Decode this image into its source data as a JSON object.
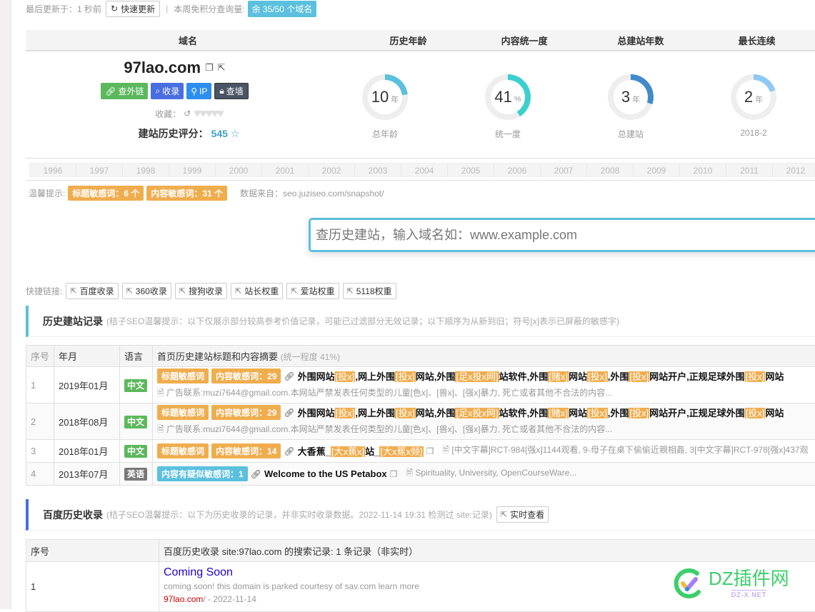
{
  "status": {
    "last_update_label": "最后更新于：1 秒前",
    "refresh_button": "快速更新",
    "separator": "|",
    "quota_label": "本周免积分查询量:",
    "quota_badge": "余 35/50 个域名"
  },
  "summary": {
    "headers": [
      "域名",
      "历史年龄",
      "内容统一度",
      "总建站年数",
      "最长连续"
    ],
    "domain": "97lao.com",
    "actions": [
      "查外链",
      "收录",
      "IP",
      "查墙"
    ],
    "favorite_label": "收藏：",
    "hearts": "♥♥♥♥♥",
    "score_label": "建站历史评分：",
    "score_value": "545",
    "gauges": [
      {
        "value": "10",
        "unit": "年",
        "label": "总年龄",
        "fraction": 0.23,
        "color": "#5bc0de"
      },
      {
        "value": "41",
        "unit": "%",
        "label": "统一度",
        "fraction": 0.41,
        "color": "#3ccfcf"
      },
      {
        "value": "3",
        "unit": "年",
        "label": "总建站",
        "fraction": 0.3,
        "color": "#428bca"
      },
      {
        "value": "2",
        "unit": "年",
        "label": "2018-2",
        "fraction": 0.2,
        "color": "#8ec9f5"
      }
    ]
  },
  "years": [
    "1996",
    "1997",
    "1998",
    "1999",
    "2000",
    "2001",
    "2002",
    "2003",
    "2004",
    "2005",
    "2006",
    "2007",
    "2008",
    "2009",
    "2010",
    "2011",
    "2012"
  ],
  "tips": {
    "label": "温馨提示:",
    "title_sensitive": "标题敏感词：6 个",
    "content_sensitive": "内容敏感词：31 个",
    "source": "数据来自：seo.juziseo.com/snapshot/"
  },
  "search": {
    "placeholder": "查历史建站，输入域名如：www.example.com",
    "value": ""
  },
  "quick_links": {
    "label": "快捷链接:",
    "items": [
      "百度收录",
      "360收录",
      "搜狗收录",
      "站长权重",
      "爱站权重",
      "5118权重"
    ]
  },
  "history_section": {
    "title": "历史建站记录",
    "hint": "(桔子SEO温馨提示：以下仅展示部分较高参考价值记录，可能已过滤部分无效记录；以下顺序为从新到旧；符号[x]表示已屏蔽的敏感字)",
    "columns": [
      "序号",
      "年月",
      "语言",
      "首页历史建站标题和内容摘要"
    ],
    "col_hint": "(统一程度 41%)",
    "rows": [
      {
        "idx": "1",
        "date": "2019年01月",
        "lang": "中文",
        "tags": [
          "标题敏感词",
          "内容敏感词：29"
        ],
        "title_parts": [
          "外围网站",
          "[投x]",
          ",网上外围",
          "[投x]",
          "网站,外围",
          "[足x投x网]",
          "站软件,外围",
          "[赌x]",
          "网站",
          "[投x]",
          ",外围",
          "[投x]",
          "网站开户,正规足球外围",
          "[投x]",
          "网站"
        ],
        "summary": "广告联系:muzi7644@gmail.com.本网站严禁发表任何类型的儿童[色x]、[兽x]、[强x]暴力, 死亡或者其他不合法的内容..."
      },
      {
        "idx": "2",
        "date": "2018年08月",
        "lang": "中文",
        "tags": [
          "标题敏感词",
          "内容敏感词：29"
        ],
        "title_parts": [
          "外围网站",
          "[投x]",
          ",网上外围",
          "[投x]",
          "网站,外围",
          "[足x投x网]",
          "站软件,外围",
          "[赌x]",
          "网站",
          "[投x]",
          ",外围",
          "[投x]",
          "网站开户,正规足球外围",
          "[投x]",
          "网站"
        ],
        "summary": "广告联系:muzi7644@gmail.com.本网站严禁发表任何类型的儿童[色x]、[兽x]、[强x]暴力, 死亡或者其他不合法的内容..."
      },
      {
        "idx": "3",
        "date": "2018年01月",
        "lang": "中文",
        "tags": [
          "标题敏感词",
          "内容敏感词：14"
        ],
        "title_parts": [
          "大香蕉_",
          "[大x蕉x]",
          "站_",
          "[大x蕉x频]"
        ],
        "summary": "[中文字幕]RCT-984[强x]1144观看, 9-母子在桌下偷偷近親相姦, 3[中文字幕]RCT-978[强x]437观"
      },
      {
        "idx": "4",
        "date": "2013年07月",
        "lang": "英语",
        "tags": [
          "内容有疑似敏感词：1"
        ],
        "title_parts": [
          "Welcome to the US Petabox"
        ],
        "summary": "Spirituality, University, OpenCourseWare..."
      }
    ]
  },
  "baidu_section": {
    "title": "百度历史收录",
    "hint": "(桔子SEO温馨提示：以下为历史收录的记录，并非实时收录数据。2022-11-14 19:31 检测过 site:记录)",
    "realtime_button": "实时查看",
    "columns": [
      "序号",
      "百度历史收录 site:97lao.com 的搜索记录: 1 条记录（非实时）"
    ],
    "rows": [
      {
        "idx": "1",
        "title": "Coming Soon",
        "desc": "coming soon! this domain is parked courtesy of sav.com learn more",
        "url": "97lao.com",
        "url_suffix": "/ - 2022-11-14"
      }
    ]
  },
  "watermark": {
    "main": "DZ插件网",
    "sub": "DZ-X.NET"
  }
}
